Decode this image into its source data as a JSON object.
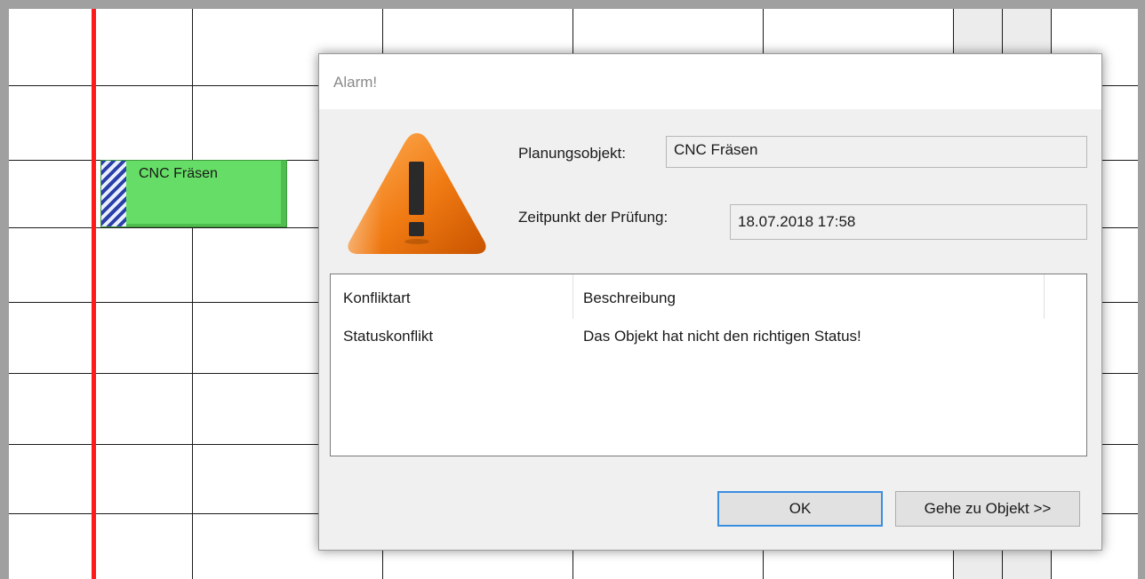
{
  "dialog": {
    "title": "Alarm!",
    "planning_object_label": "Planungsobjekt:",
    "planning_object_value": "CNC Fräsen",
    "check_time_label": "Zeitpunkt der Prüfung:",
    "check_time_value": "18.07.2018  17:58",
    "list": {
      "columns": [
        "Konfliktart",
        "Beschreibung"
      ],
      "rows": [
        {
          "type": "Statuskonflikt",
          "description": "Das Objekt hat nicht den richtigen Status!"
        }
      ]
    },
    "ok_label": "OK",
    "goto_label": "Gehe zu Objekt >>"
  },
  "gantt": {
    "task_label": "CNC Fräsen",
    "task_color": "#66dd66",
    "timeline_color": "#ff1a1a"
  },
  "icons": {
    "warning": "warning-triangle-icon"
  }
}
